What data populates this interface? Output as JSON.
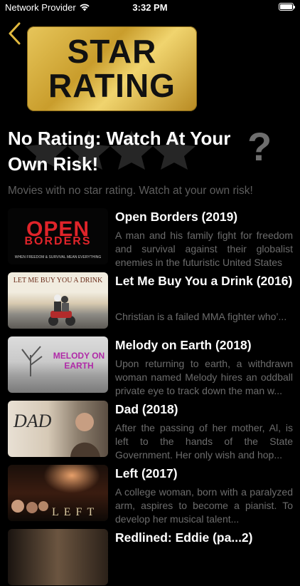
{
  "status_bar": {
    "carrier": "Network Provider",
    "time": "3:32 PM"
  },
  "header": {
    "badge_line1": "STAR",
    "badge_line2": "RATING",
    "question_mark": "?"
  },
  "page": {
    "title": "No Rating: Watch At Your Own Risk!",
    "subtitle": "Movies with no star rating. Watch at your own risk!"
  },
  "movies": [
    {
      "title": "Open Borders (2019)",
      "description": "A man and his family fight for freedom and survival against their globalist enemies in the futuristic United States",
      "thumb_text": "OPEN",
      "thumb_text2": "BORDERS",
      "thumb_tagline": "WHEN FREEDOM & SURVIVAL MEAN EVERYTHING"
    },
    {
      "title": "Let Me Buy You a Drink (2016)",
      "description": "Christian is a failed MMA fighter who’...",
      "thumb_text": "LET ME BUY YOU A DRINK"
    },
    {
      "title": "Melody on Earth (2018)",
      "description": "Upon returning to earth, a withdrawn woman named Melody hires an oddball private eye to track down the man w...",
      "thumb_text": "MELODY ON EARTH"
    },
    {
      "title": "Dad (2018)",
      "description": "After the passing of her mother, Al, is left to the hands of the State Government. Her only wish and hop...",
      "thumb_text": "DAD"
    },
    {
      "title": "Left (2017)",
      "description": "A college woman, born with a paralyzed arm, aspires to become a pianist. To develop her musical talent...",
      "thumb_text": "LEFT"
    },
    {
      "title": "Redlined: Eddie (pa...2)"
    }
  ]
}
